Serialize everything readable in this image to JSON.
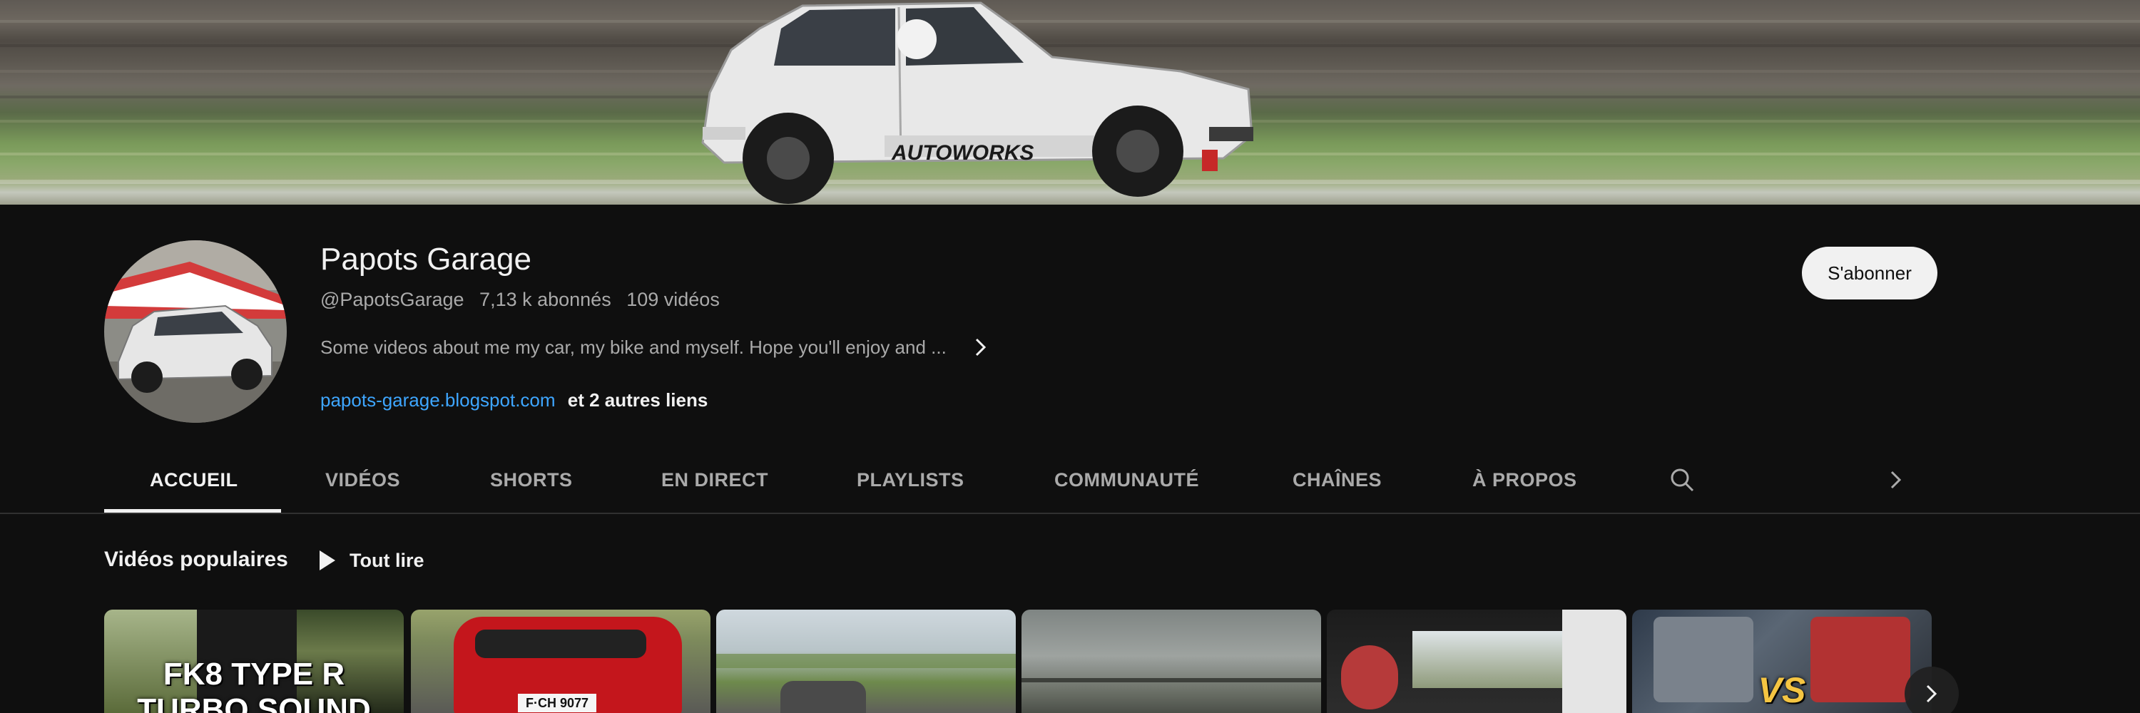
{
  "channel": {
    "name": "Papots Garage",
    "handle": "@PapotsGarage",
    "subscribers": "7,13 k abonnés",
    "videos": "109 vidéos",
    "description": "Some videos about me my car, my bike and myself. Hope you'll enjoy and ...",
    "link": "papots-garage.blogspot.com",
    "more_links": "et 2 autres liens",
    "subscribe_label": "S'abonner",
    "banner_text": "AUTOWORKS"
  },
  "tabs": [
    {
      "label": "ACCUEIL",
      "active": true
    },
    {
      "label": "VIDÉOS",
      "active": false
    },
    {
      "label": "SHORTS",
      "active": false
    },
    {
      "label": "EN DIRECT",
      "active": false
    },
    {
      "label": "PLAYLISTS",
      "active": false
    },
    {
      "label": "COMMUNAUTÉ",
      "active": false
    },
    {
      "label": "CHAÎNES",
      "active": false
    },
    {
      "label": "À PROPOS",
      "active": false
    }
  ],
  "tab_icons": [
    "search-icon",
    "chevron-right-icon"
  ],
  "shelf": {
    "title": "Vidéos populaires",
    "play_all": "Tout lire",
    "thumbnails": [
      {
        "caption_line1": "FK8 TYPE R",
        "caption_line2": "TURBO SOUND"
      },
      {
        "plate": "F·CH 9077"
      },
      {},
      {},
      {},
      {
        "caption": "VS"
      }
    ]
  },
  "colors": {
    "background": "#0f0f0f",
    "text_primary": "#f1f1f1",
    "text_secondary": "#aaaaaa",
    "link": "#3ea6ff",
    "subscribe_bg": "#f1f1f1"
  }
}
